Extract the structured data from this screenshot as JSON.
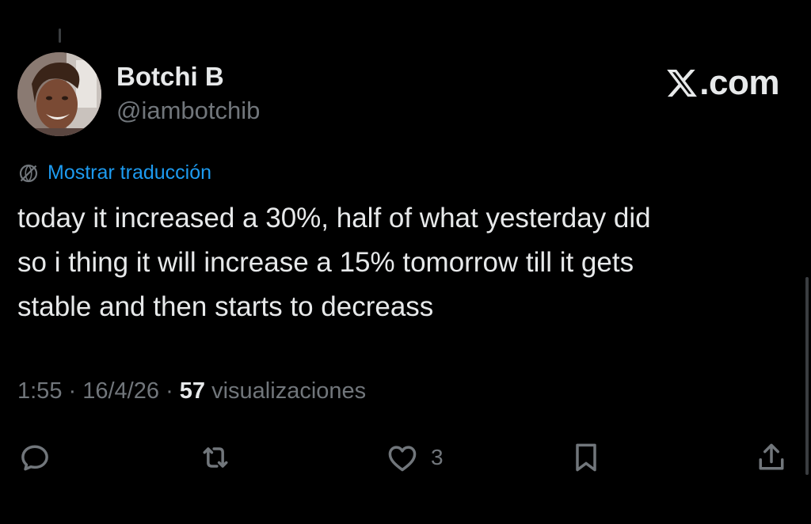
{
  "author": {
    "display_name": "Botchi B",
    "handle": "@iambotchib",
    "avatar_icon": "user-avatar-photo"
  },
  "brand": {
    "logo_icon": "x-logo-icon",
    "suffix": ".com"
  },
  "translation": {
    "icon": "globe-icon",
    "label": "Mostrar traducción",
    "color": "#1d9bf0"
  },
  "tweet": {
    "text": "today it increased a 30%, half of what yesterday did\nso i thing it will increase a 15% tomorrow till it gets\nstable and then starts to decreass",
    "time": "1:55",
    "date": "16/4/26",
    "views_count": "57",
    "views_label": "visualizaciones"
  },
  "actions": {
    "reply": {
      "icon": "reply-icon"
    },
    "repost": {
      "icon": "repost-icon"
    },
    "like": {
      "icon": "heart-icon",
      "count": "3"
    },
    "bookmark": {
      "icon": "bookmark-icon"
    },
    "share": {
      "icon": "share-icon"
    }
  },
  "colors": {
    "background": "#000000",
    "primary_text": "#e7e9ea",
    "secondary_text": "#71767b",
    "accent": "#1d9bf0"
  }
}
